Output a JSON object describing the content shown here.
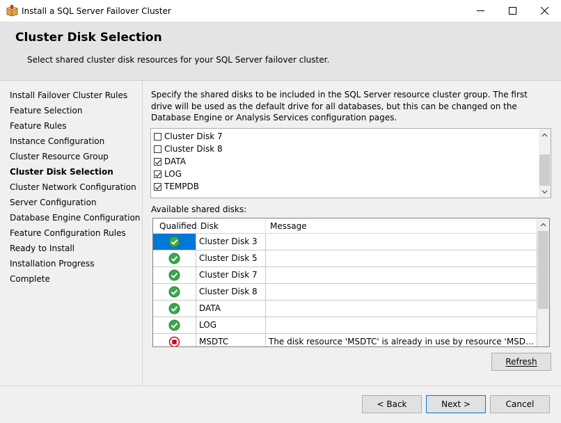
{
  "window": {
    "title": "Install a SQL Server Failover Cluster",
    "minimize_glyph": "—",
    "maximize_glyph": "☐",
    "close_glyph": "✕",
    "icon": "installer-box-icon"
  },
  "header": {
    "title": "Cluster Disk Selection",
    "subtitle": "Select shared cluster disk resources for your SQL Server failover cluster."
  },
  "nav": {
    "active_index": 5,
    "items": [
      "Install Failover Cluster Rules",
      "Feature Selection",
      "Feature Rules",
      "Instance Configuration",
      "Cluster Resource Group",
      "Cluster Disk Selection",
      "Cluster Network Configuration",
      "Server Configuration",
      "Database Engine Configuration",
      "Feature Configuration Rules",
      "Ready to Install",
      "Installation Progress",
      "Complete"
    ]
  },
  "main": {
    "description": "Specify the shared disks to be included in the SQL Server resource cluster group. The first drive will be used as the default drive for all databases, but this can be changed on the Database Engine or Analysis Services configuration pages.",
    "disk_list": [
      {
        "label": "Cluster Disk 7",
        "checked": false
      },
      {
        "label": "Cluster Disk 8",
        "checked": false
      },
      {
        "label": "DATA",
        "checked": true
      },
      {
        "label": "LOG",
        "checked": true
      },
      {
        "label": "TEMPDB",
        "checked": true
      }
    ],
    "available_label": "Available shared disks:",
    "grid": {
      "columns": [
        "Qualified",
        "Disk",
        "Message"
      ],
      "rows": [
        {
          "status": "ok",
          "disk": "Cluster Disk 3",
          "message": ""
        },
        {
          "status": "ok",
          "disk": "Cluster Disk 5",
          "message": ""
        },
        {
          "status": "ok",
          "disk": "Cluster Disk 7",
          "message": ""
        },
        {
          "status": "ok",
          "disk": "Cluster Disk 8",
          "message": ""
        },
        {
          "status": "ok",
          "disk": "DATA",
          "message": ""
        },
        {
          "status": "ok",
          "disk": "LOG",
          "message": ""
        },
        {
          "status": "error",
          "disk": "MSDTC",
          "message": "The disk resource 'MSDTC' is already in use by resource 'MSDTC-MSDTC..."
        }
      ]
    },
    "refresh_label": "Refresh"
  },
  "footer": {
    "back_label": "< Back",
    "next_label": "Next >",
    "cancel_label": "Cancel"
  },
  "colors": {
    "selection": "#0078d7",
    "ok_green": "#3aa84a",
    "error_red": "#d0021b"
  }
}
